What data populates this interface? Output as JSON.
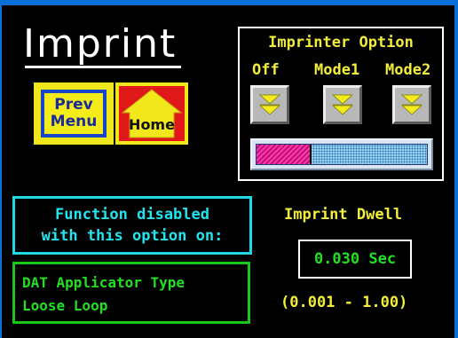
{
  "title": "Imprint",
  "nav": {
    "prev_line1": "Prev",
    "prev_line2": "Menu",
    "home": "Home"
  },
  "imprinter_option": {
    "title": "Imprinter Option",
    "options": [
      "Off",
      "Mode1",
      "Mode2"
    ],
    "icon": "double-chevron-down-icon",
    "slider_fill_fraction": 0.31
  },
  "disabled_notice": {
    "line1": "Function disabled",
    "line2": "with this option on:"
  },
  "disabled_functions": {
    "line1": "DAT Applicator Type",
    "line2": "Loose Loop"
  },
  "dwell": {
    "label": "Imprint Dwell",
    "value": "0.030 Sec",
    "range": "(0.001 - 1.00)"
  },
  "colors": {
    "frame": "#0a6fd8",
    "label_yellow": "#f2ee3a",
    "cyan": "#20d8e6",
    "green": "#20e020",
    "home_red": "#e01818",
    "slider_fill": "#ff3aa8"
  }
}
